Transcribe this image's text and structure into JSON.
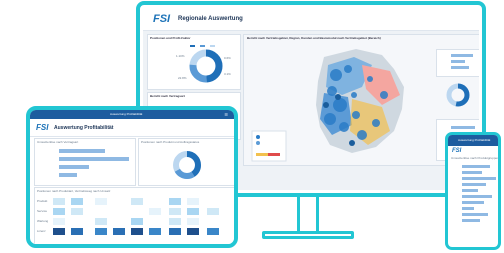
{
  "colors": {
    "frame": "#22c6d3",
    "brand": "#1d73b8",
    "header_dark": "#1d5c9f",
    "bar_blue": "#8fb9e3",
    "map_high": "#1e6fb8",
    "map_low": "#f4a6a0"
  },
  "monitor": {
    "logo": "FSI",
    "title": "Regionale Auswertung",
    "left_panel_title": "Positionen und Profit-Faktor",
    "lower_panel_title": "Bericht nach Vertragsart",
    "map_title": "Bericht nach Vertriebsgebiet, Region, Kunden und Basismodul nach Vertriebsgebiet (Bereich)",
    "donut_labels": [
      "1.10%",
      "0.6%",
      "3.1%",
      "22.8%"
    ]
  },
  "tablet": {
    "status_title": "Auswertung Profitabilität",
    "logo": "FSI",
    "title": "Auswertung Profitabilität",
    "chart_title": "Umsatzerlöse nach Vertragsart",
    "donut_title": "Positionen nach Produkt und Auftragsstatus",
    "heat_title": "Positionen nach Produktart, Vertriebsweg nach Umsatz",
    "row_labels": [
      "Produkt",
      "Service",
      "Wartung",
      "Lizenz"
    ]
  },
  "phone": {
    "header": "Auswertung Profitabilität",
    "logo": "FSI",
    "section": "Umsatzerlöse nach Produktgruppen"
  }
}
